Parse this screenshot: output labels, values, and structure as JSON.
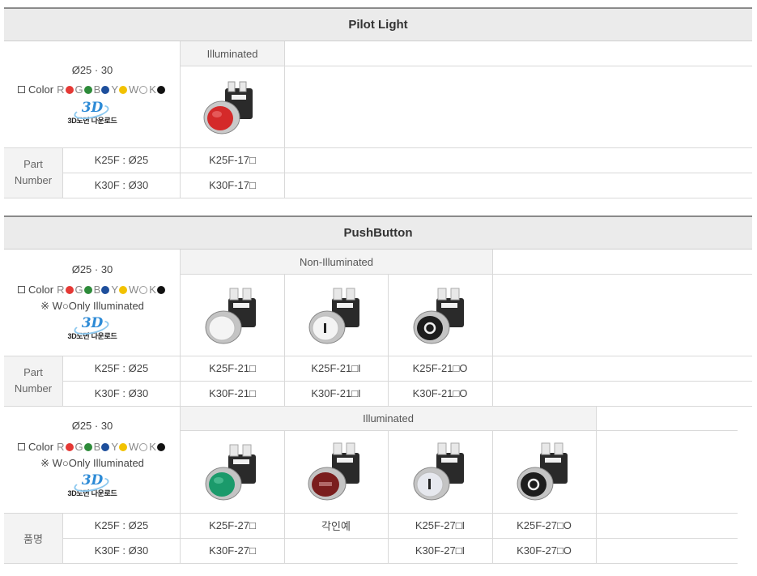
{
  "pilot": {
    "title": "Pilot Light",
    "dims": "Ø25 · 30",
    "color_label": "Color",
    "colors": [
      {
        "letter": "R",
        "hex": "#e53935"
      },
      {
        "letter": "G",
        "hex": "#2e8b3a"
      },
      {
        "letter": "B",
        "hex": "#1e4f9c"
      },
      {
        "letter": "Y",
        "hex": "#f2c200"
      },
      {
        "letter": "W",
        "hex": "#ffffff"
      },
      {
        "letter": "K",
        "hex": "#111111"
      }
    ],
    "download_caption": "3D도면 다운로드",
    "illuminated_label": "Illuminated",
    "part_label": "Part Number",
    "rows": [
      {
        "spec": "K25F : Ø25",
        "model": "K25F-17□"
      },
      {
        "spec": "K30F : Ø30",
        "model": "K30F-17□"
      }
    ]
  },
  "push": {
    "title": "PushButton",
    "dims": "Ø25 · 30",
    "color_label": "Color",
    "note": "※ W○Only Illuminated",
    "download_caption": "3D도면 다운로드",
    "non_illuminated_label": "Non-Illuminated",
    "illuminated_label": "Illuminated",
    "part_label": "Part Number",
    "non_rows": [
      {
        "spec": "K25F : Ø25",
        "models": [
          "K25F-21□",
          "K25F-21□I",
          "K25F-21□O"
        ]
      },
      {
        "spec": "K30F : Ø30",
        "models": [
          "K30F-21□",
          "K30F-21□I",
          "K30F-21□O"
        ]
      }
    ],
    "ill_part_label": "품명",
    "ill_rows": [
      {
        "spec": "K25F : Ø25",
        "models": [
          "K25F-27□",
          "각인예",
          "K25F-27□I",
          "K25F-27□O"
        ]
      },
      {
        "spec": "K30F : Ø30",
        "models": [
          "K30F-27□",
          "",
          "K30F-27□I",
          "K30F-27□O"
        ]
      }
    ]
  }
}
